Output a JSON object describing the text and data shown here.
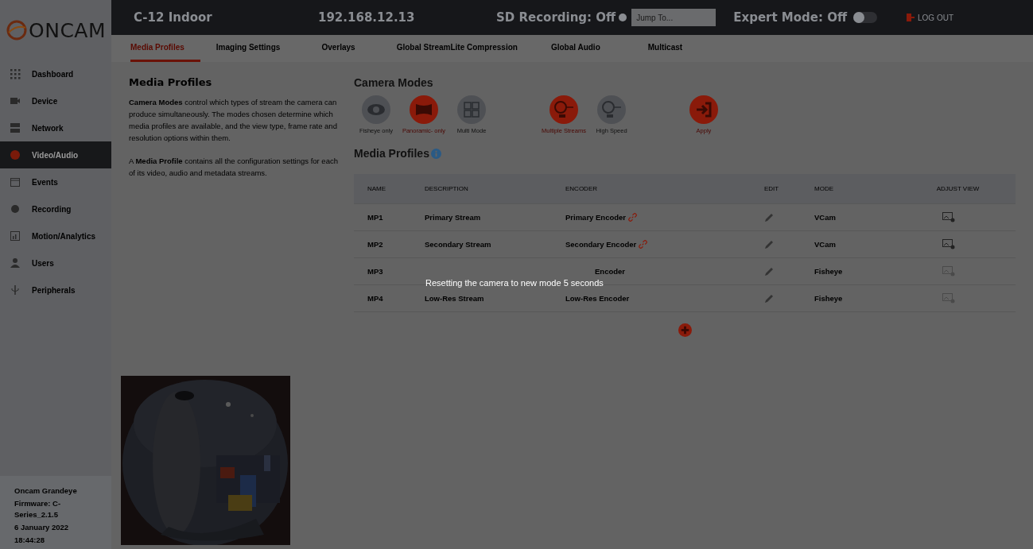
{
  "brand": {
    "name": "ONCAM"
  },
  "header": {
    "device": "C-12 Indoor",
    "ip": "192.168.12.13",
    "sd_recording": "SD Recording: Off",
    "sd_on": false,
    "jump_placeholder": "Jump To...",
    "expert_mode": "Expert Mode: Off",
    "expert_on": false,
    "logout": "LOG OUT"
  },
  "sidebar": {
    "items": [
      {
        "label": "Dashboard",
        "selected": false
      },
      {
        "label": "Device",
        "selected": false
      },
      {
        "label": "Network",
        "selected": false
      },
      {
        "label": "Video/Audio",
        "selected": true
      },
      {
        "label": "Events",
        "selected": false
      },
      {
        "label": "Recording",
        "selected": false
      },
      {
        "label": "Motion/Analytics",
        "selected": false
      },
      {
        "label": "Users",
        "selected": false
      },
      {
        "label": "Peripherals",
        "selected": false
      }
    ],
    "footer": [
      "Oncam Grandeye",
      "Firmware: C-Series_2.1.5",
      "6 January 2022",
      "18:44:28"
    ]
  },
  "tabs": [
    {
      "label": "Media Profiles",
      "selected": true
    },
    {
      "label": "Imaging Settings",
      "selected": false
    },
    {
      "label": "Overlays",
      "selected": false
    },
    {
      "label": "Global StreamLite Compression",
      "selected": false
    },
    {
      "label": "Global Audio",
      "selected": false
    },
    {
      "label": "Multicast",
      "selected": false
    }
  ],
  "help": {
    "title": "Media Profiles",
    "paragraphs": [
      "**Camera Modes** control which types of stream the camera can produce simultaneously. The modes chosen determine which media profiles are available, and the view type, frame rate and resolution options within them.",
      "A **Media Profile** contains all the configuration settings for each of its video, audio and metadata streams."
    ]
  },
  "camera_modes": {
    "title": "Camera Modes",
    "groups": [
      [
        {
          "label": "Fisheye only",
          "selected": false
        },
        {
          "label": "Panoramic- only",
          "selected": true
        },
        {
          "label": "Multi Mode",
          "selected": false
        }
      ],
      [
        {
          "label": "Multiple Streams",
          "selected": true
        },
        {
          "label": "High Speed",
          "selected": false
        }
      ],
      [
        {
          "label": "Apply",
          "selected": true
        }
      ]
    ]
  },
  "media_profiles": {
    "title": "Media Profiles",
    "columns": [
      "NAME",
      "DESCRIPTION",
      "ENCODER",
      "EDIT",
      "MODE",
      "ADJUST VIEW"
    ],
    "rows": [
      {
        "name": "MP1",
        "description": "Primary Stream",
        "encoder": "Primary Encoder",
        "linked": true,
        "mode": "VCam",
        "adjust_enabled": true,
        "covered": false
      },
      {
        "name": "MP2",
        "description": "Secondary Stream",
        "encoder": "Secondary Encoder",
        "linked": true,
        "mode": "VCam",
        "adjust_enabled": true,
        "covered": false
      },
      {
        "name": "MP3",
        "encoder": "Encoder",
        "linked": false,
        "mode": "Fisheye",
        "adjust_enabled": false,
        "covered": true
      },
      {
        "name": "MP4",
        "description": "Low-Res Stream",
        "encoder": "Low-Res Encoder",
        "linked": false,
        "mode": "Fisheye",
        "adjust_enabled": false,
        "covered": false
      }
    ]
  },
  "message": "Resetting the camera to new mode 5 seconds"
}
